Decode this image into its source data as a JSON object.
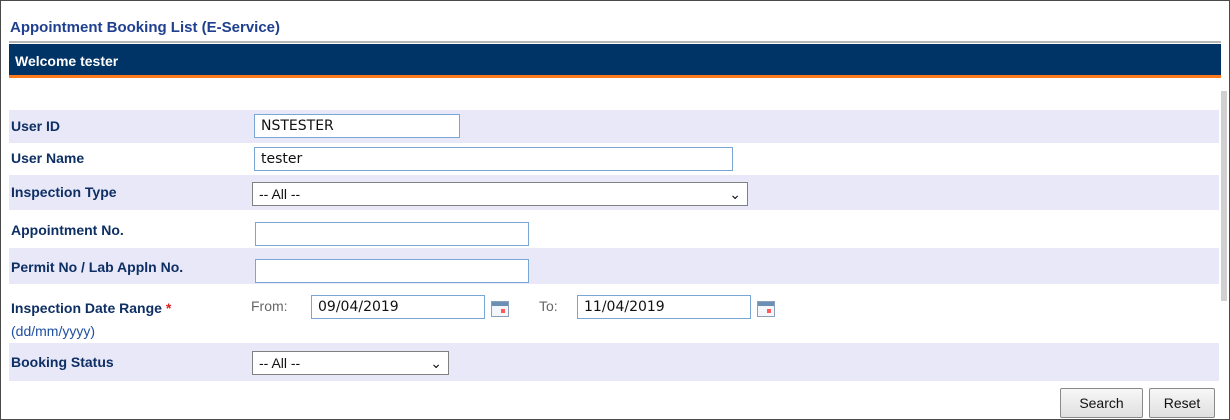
{
  "page": {
    "title": "Appointment Booking List (E-Service)",
    "welcome": "Welcome tester"
  },
  "form": {
    "user_id": {
      "label": "User ID",
      "value": "NSTESTER"
    },
    "user_name": {
      "label": "User Name",
      "value": "tester"
    },
    "inspection_type": {
      "label": "Inspection Type",
      "selected": "-- All --"
    },
    "appointment_no": {
      "label": "Appointment No.",
      "value": ""
    },
    "permit_no": {
      "label": "Permit No / Lab Appln No.",
      "value": ""
    },
    "inspection_date_range": {
      "label": "Inspection Date Range",
      "required_mark": "*",
      "hint": "(dd/mm/yyyy)",
      "from_label": "From:",
      "from_value": "09/04/2019",
      "to_label": "To:",
      "to_value": "11/04/2019"
    },
    "booking_status": {
      "label": "Booking Status",
      "selected": "-- All --"
    }
  },
  "actions": {
    "search": "Search",
    "reset": "Reset"
  },
  "colors": {
    "header_bg": "#003366",
    "header_accent": "#ff7a1a",
    "row_shade": "#e8e8f8"
  }
}
